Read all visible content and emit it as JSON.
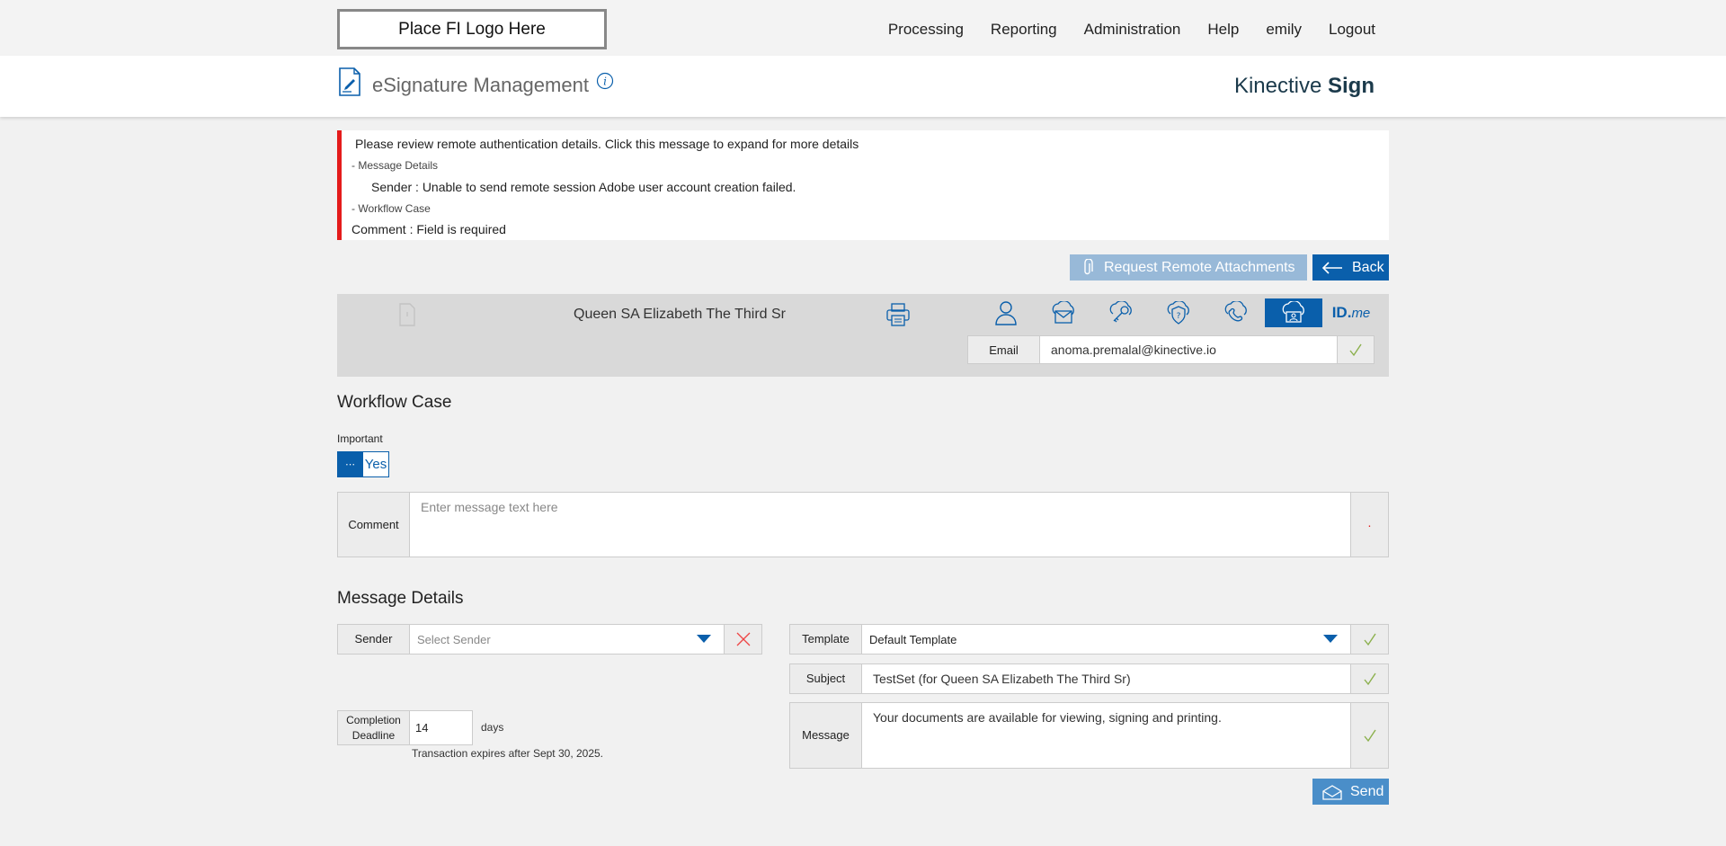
{
  "header": {
    "logo_text": "Place FI Logo Here",
    "nav": [
      "Processing",
      "Reporting",
      "Administration",
      "Help",
      "emily",
      "Logout"
    ]
  },
  "titlebar": {
    "title": "eSignature Management",
    "brand_light": "Kinective",
    "brand_bold": "Sign"
  },
  "alert": {
    "summary": "Please review remote authentication details. Click this message to expand for more details",
    "group1": "- Message Details",
    "line1": "Sender :  Unable to send remote session Adobe user account creation failed.",
    "group2": "- Workflow Case",
    "line2": "Comment :  Field is required"
  },
  "actions": {
    "attach_label": "Request Remote Attachments",
    "back_label": "Back"
  },
  "signer": {
    "name": "Queen SA Elizabeth The Third Sr",
    "auth_methods": [
      "person-icon",
      "cloud-mail-icon",
      "cloud-key-icon",
      "shield-question-icon",
      "phone-icon",
      "cloud-id-icon",
      "idme-icon"
    ],
    "active_auth": "cloud-id-icon",
    "idme_text": "ID.",
    "idme_suffix": "me",
    "email_label": "Email",
    "email_value": "anoma.premalal@kinective.io"
  },
  "workflow": {
    "heading": "Workflow Case",
    "important_label": "Important",
    "toggle_knob": "⋯",
    "toggle_value": "Yes",
    "comment_label": "Comment",
    "comment_placeholder": "Enter message text here",
    "required_mark": "·"
  },
  "message": {
    "heading": "Message Details",
    "sender_label": "Sender",
    "sender_placeholder": "Select Sender",
    "template_label": "Template",
    "template_value": "Default Template",
    "subject_label": "Subject",
    "subject_value": "TestSet (for Queen SA Elizabeth The Third Sr)",
    "message_label": "Message",
    "message_value": "Your documents are available for viewing, signing and printing.",
    "deadline_label_1": "Completion",
    "deadline_label_2": "Deadline",
    "deadline_value": "14",
    "days_label": "days",
    "expires_text": "Transaction expires after Sept 30, 2025.",
    "send_label": "Send"
  },
  "colors": {
    "primary": "#0a5fab",
    "primary_light": "#98b9d8",
    "error": "#e41b1b",
    "check": "#8bb04c"
  }
}
